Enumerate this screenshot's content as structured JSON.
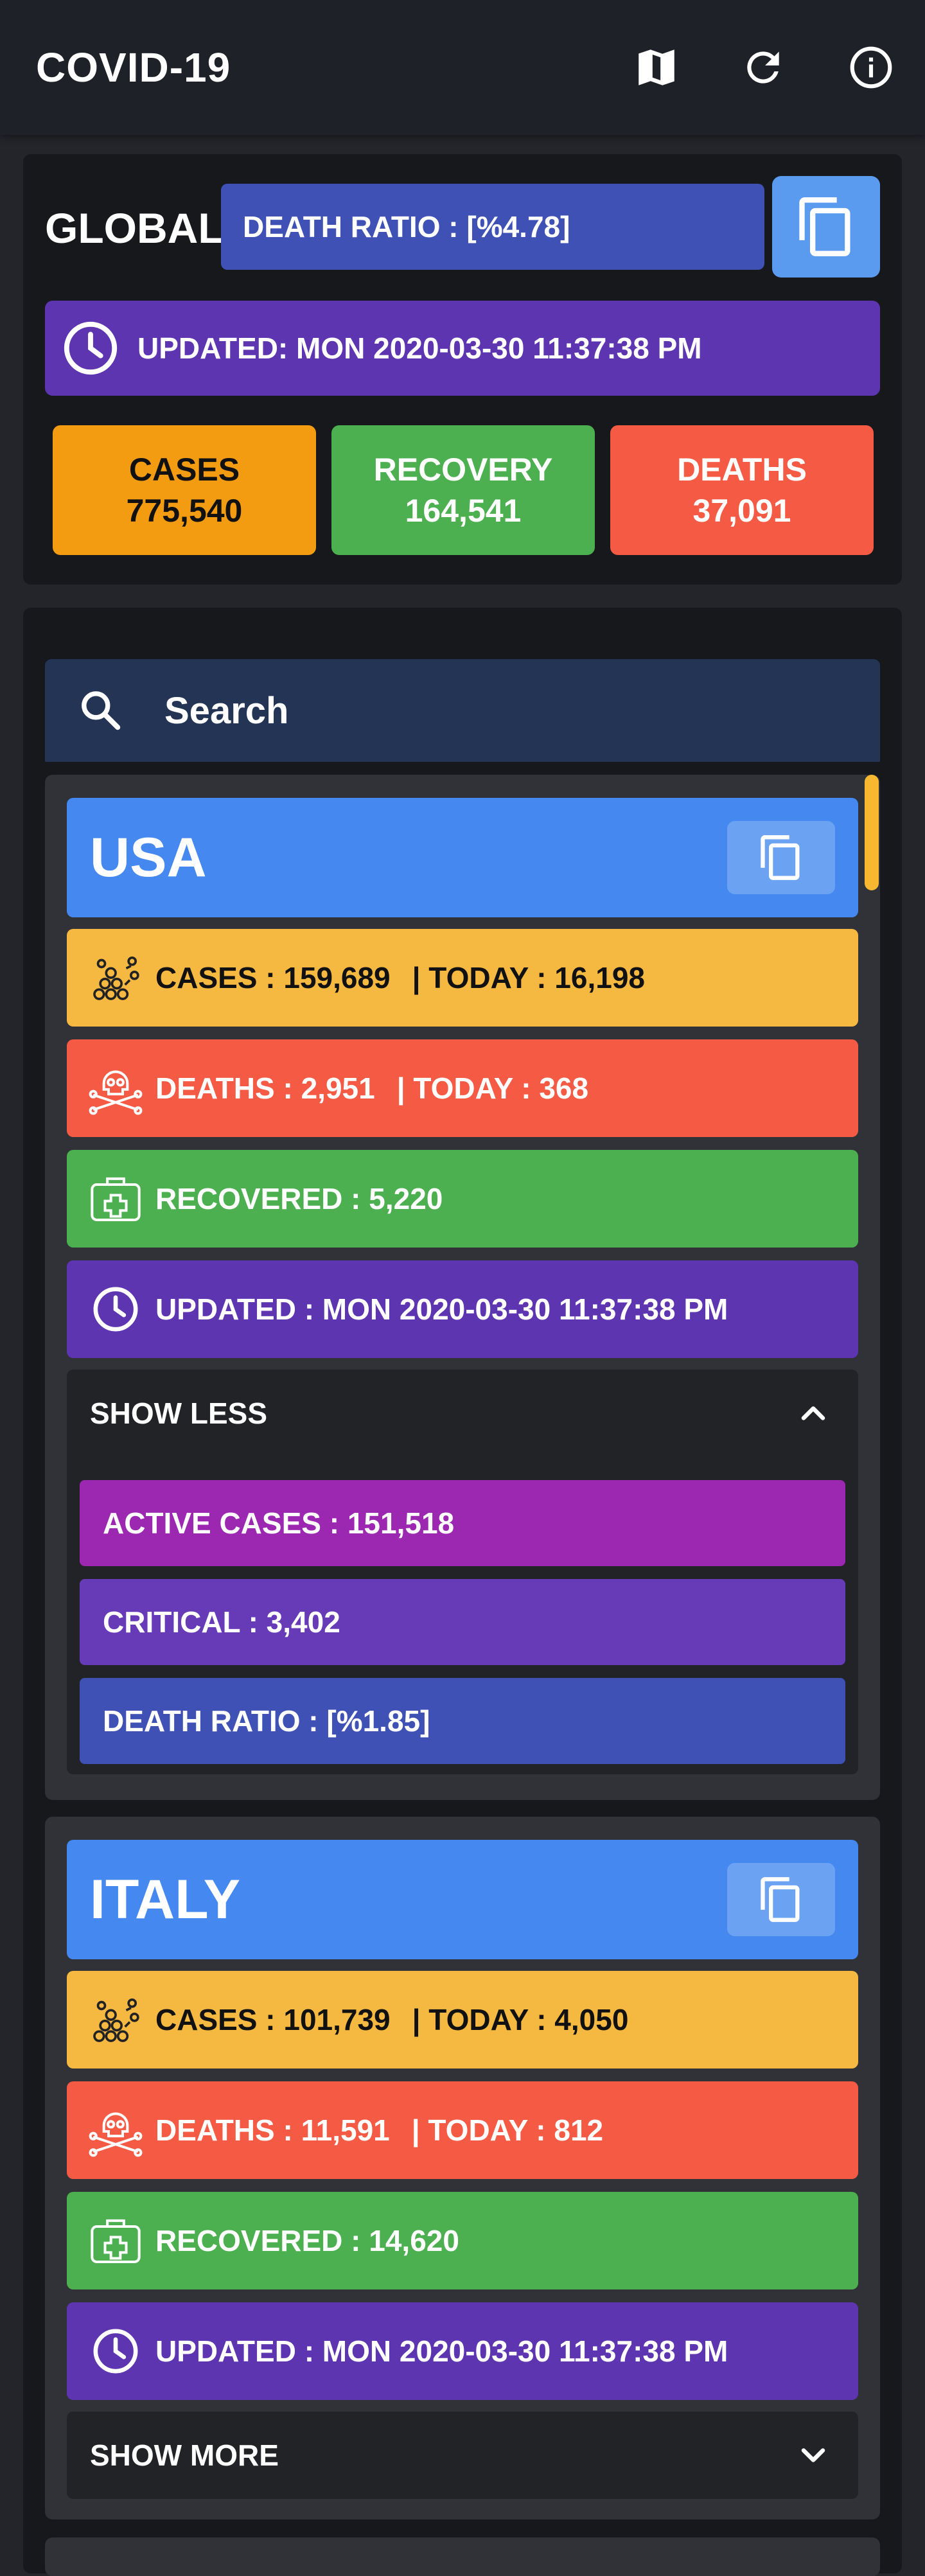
{
  "app": {
    "title": "COVID-19",
    "icons": [
      "map-icon",
      "refresh-icon",
      "info-icon"
    ]
  },
  "global": {
    "label": "GLOBAL",
    "death_ratio": "DEATH RATIO : [%4.78]",
    "updated": "UPDATED: MON 2020-03-30 11:37:38 PM",
    "cases_label": "CASES",
    "cases_value": "775,540",
    "recovery_label": "RECOVERY",
    "recovery_value": "164,541",
    "deaths_label": "DEATHS",
    "deaths_value": "37,091"
  },
  "search": {
    "placeholder": "Search"
  },
  "countries": [
    {
      "name": "USA",
      "cases": "CASES : 159,689",
      "cases_today": "| TODAY : 16,198",
      "deaths": "DEATHS : 2,951",
      "deaths_today": "| TODAY : 368",
      "recovered": "RECOVERED : 5,220",
      "updated": "UPDATED : MON 2020-03-30 11:37:38 PM",
      "toggle_label": "SHOW LESS",
      "active": "ACTIVE CASES : 151,518",
      "critical": "CRITICAL : 3,402",
      "death_ratio": "DEATH RATIO : [%1.85]"
    },
    {
      "name": "ITALY",
      "cases": "CASES : 101,739",
      "cases_today": "| TODAY : 4,050",
      "deaths": "DEATHS : 11,591",
      "deaths_today": "| TODAY : 812",
      "recovered": "RECOVERED : 14,620",
      "updated": "UPDATED : MON 2020-03-30 11:37:38 PM",
      "toggle_label": "SHOW MORE"
    }
  ],
  "colors": {
    "background": "#23252b",
    "appbar": "#1e2127",
    "card": "#17181c",
    "death_ratio": "#3f51b5",
    "updated": "#5e35b1",
    "cases": "#f39c12",
    "cases_row": "#f5b942",
    "recovery": "#4caf50",
    "deaths": "#f55a45",
    "country_header": "#4488f0",
    "active_cases": "#9c27b0",
    "critical": "#673ab7",
    "search": "#233455"
  }
}
